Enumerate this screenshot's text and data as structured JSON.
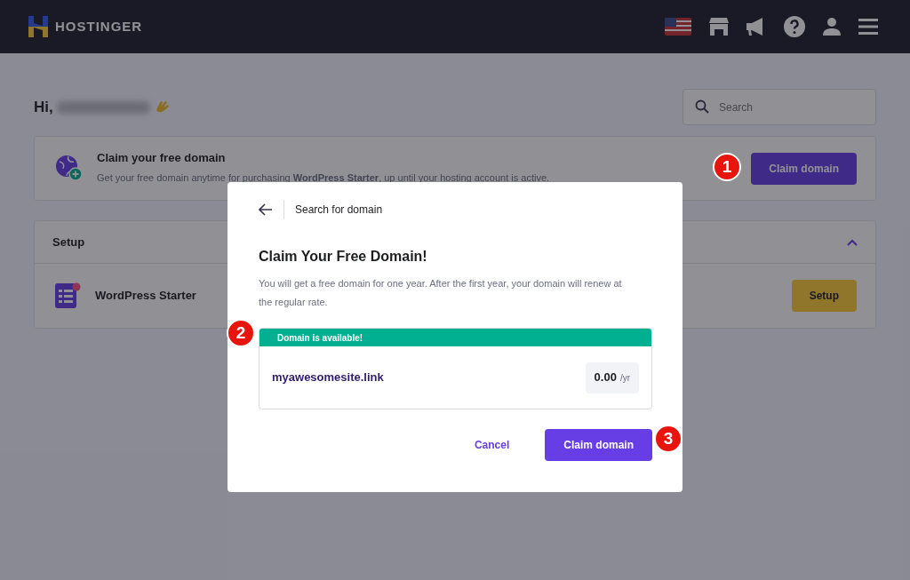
{
  "header": {
    "logo": "HOSTINGER"
  },
  "greeting": {
    "text": "Hi,"
  },
  "search": {
    "placeholder": "Search"
  },
  "promo": {
    "title": "Claim your free domain",
    "text": "Get your free domain anytime for purchasing **WordPress Starter**, up until your hosting account is active.",
    "button": "Claim domain"
  },
  "setup": {
    "title": "Setup",
    "expanded": true,
    "items": [
      {
        "label": "WordPress Starter",
        "button": "Setup"
      }
    ]
  },
  "modal": {
    "back_label": "Search for domain",
    "title": "Claim Your Free Domain!",
    "description": "You will get a free domain for one year. After the first year, your domain will renew at the regular rate.",
    "status": "Domain is available!",
    "domain": "myawesomesite.link",
    "price": "0.00",
    "period": "/yr",
    "buttons": [
      {
        "label": "Cancel",
        "kind": "link"
      },
      {
        "label": "Claim domain",
        "kind": "primary"
      }
    ]
  },
  "callouts": [
    {
      "label": "1"
    },
    {
      "label": "2"
    },
    {
      "label": "3"
    }
  ]
}
